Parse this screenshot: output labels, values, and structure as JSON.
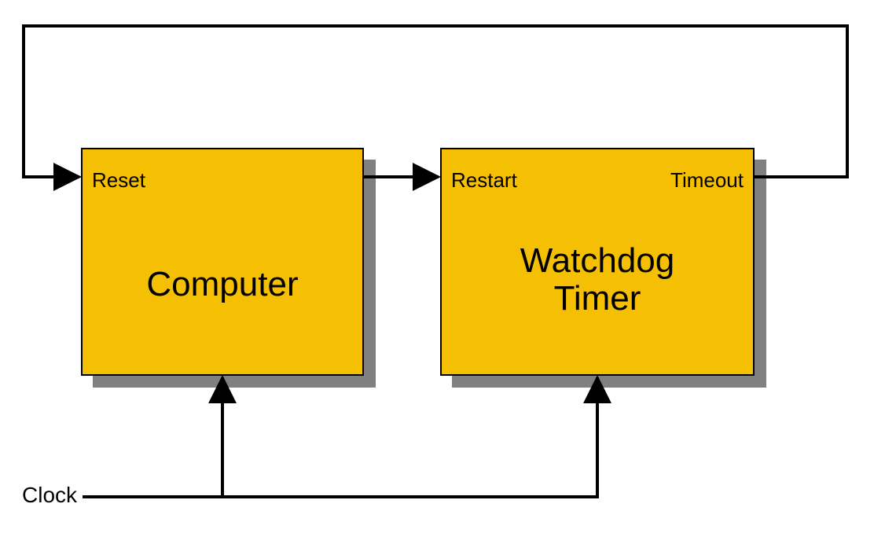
{
  "diagram": {
    "blocks": {
      "computer": {
        "title": "Computer",
        "ports": {
          "reset": "Reset"
        }
      },
      "watchdog": {
        "title": "Watchdog\nTimer",
        "ports": {
          "restart": "Restart",
          "timeout": "Timeout"
        }
      }
    },
    "signals": {
      "clock": "Clock"
    },
    "colors": {
      "block_fill": "#f5bf03",
      "shadow": "#808080",
      "stroke": "#000000"
    }
  }
}
